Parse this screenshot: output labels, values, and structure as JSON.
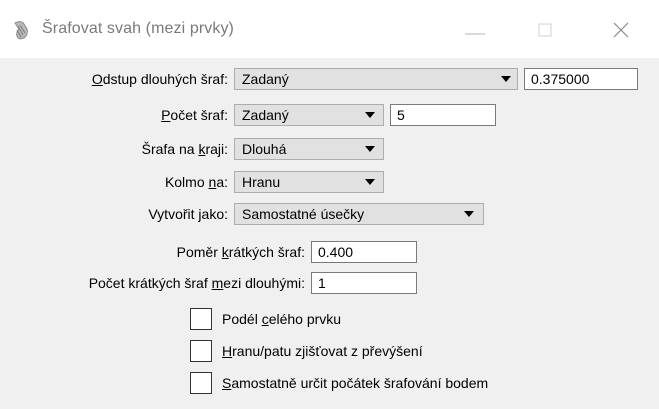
{
  "window": {
    "title": "Šrafovat svah (mezi prvky)",
    "icon": "hatch-app-icon"
  },
  "form": {
    "long_offset": {
      "label_pre": "",
      "label_ul": "O",
      "label_post": "dstup dlouhých šraf:",
      "select_value": "Zadaný",
      "input_value": "0.375000"
    },
    "hatch_count": {
      "label_pre": "",
      "label_ul": "P",
      "label_post": "očet šraf:",
      "select_value": "Zadaný",
      "input_value": "5"
    },
    "edge_hatch": {
      "label_pre": "Šrafa na ",
      "label_ul": "k",
      "label_post": "raji:",
      "select_value": "Dlouhá"
    },
    "perpendicular": {
      "label_pre": "Kolmo ",
      "label_ul": "n",
      "label_post": "a:",
      "select_value": "Hranu"
    },
    "create_as": {
      "label_pre": "Vytvořit ",
      "label_ul": "j",
      "label_post": "ako:",
      "select_value": "Samostatné úsečky"
    },
    "short_ratio": {
      "label_pre": "Poměr ",
      "label_ul": "k",
      "label_post": "rátkých šraf:",
      "input_value": "0.400"
    },
    "short_count": {
      "label_pre": "Počet krátkých šraf ",
      "label_ul": "m",
      "label_post": "ezi dlouhými:",
      "input_value": "1"
    }
  },
  "checkboxes": [
    {
      "pre": "Podél ",
      "ul": "c",
      "post": "elého prvku",
      "checked": false
    },
    {
      "pre": "",
      "ul": "H",
      "post": "ranu/patu zjišťovat z převýšení",
      "checked": false
    },
    {
      "pre": "",
      "ul": "S",
      "post": "amostatně určit počátek šrafování bodem",
      "checked": false
    }
  ]
}
